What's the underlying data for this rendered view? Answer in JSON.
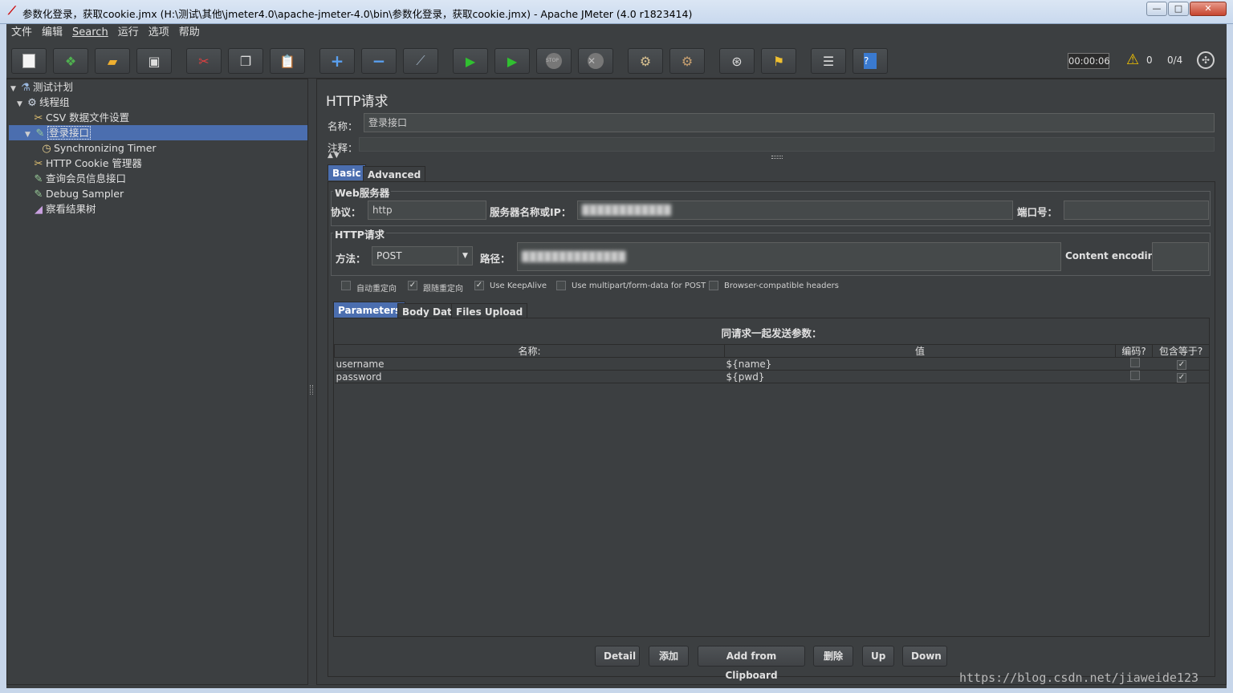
{
  "window": {
    "title": "参数化登录，获取cookie.jmx (H:\\测试\\其他\\jmeter4.0\\apache-jmeter-4.0\\bin\\参数化登录，获取cookie.jmx) - Apache JMeter (4.0 r1823414)",
    "minimize": "—",
    "maximize": "□",
    "close": "✕"
  },
  "menu": [
    "文件",
    "编辑",
    "Search",
    "运行",
    "选项",
    "帮助"
  ],
  "toolbar": {
    "timer": "00:00:06",
    "warning_count": "0",
    "threads": "0/4"
  },
  "tree": [
    {
      "label": "测试计划",
      "icon": "flask-icon"
    },
    {
      "label": "线程组",
      "icon": "gear-icon"
    },
    {
      "label": "CSV 数据文件设置",
      "icon": "scissors-icon"
    },
    {
      "label": "登录接口",
      "icon": "pipette-icon"
    },
    {
      "label": "Synchronizing Timer",
      "icon": "timer-icon"
    },
    {
      "label": "HTTP Cookie 管理器",
      "icon": "scissors-icon"
    },
    {
      "label": "查询会员信息接口",
      "icon": "pipette-icon"
    },
    {
      "label": "Debug Sampler",
      "icon": "pipette-icon"
    },
    {
      "label": "察看结果树",
      "icon": "graph-icon"
    }
  ],
  "panel": {
    "title": "HTTP请求",
    "name_label": "名称：",
    "name_value": "登录接口",
    "comment_label": "注释：",
    "tabs": [
      "Basic",
      "Advanced"
    ],
    "web_server": {
      "group_title": "Web服务器",
      "protocol_label": "协议：",
      "protocol_value": "http",
      "server_label": "服务器名称或IP：",
      "server_value": "████████████",
      "port_label": "端口号："
    },
    "http_request": {
      "group_title": "HTTP请求",
      "method_label": "方法：",
      "method_value": "POST",
      "path_label": "路径：",
      "path_value": "██████████████",
      "encoding_label": "Content encoding:"
    },
    "checkboxes": [
      {
        "label": "自动重定向",
        "checked": false
      },
      {
        "label": "跟随重定向",
        "checked": true
      },
      {
        "label": "Use KeepAlive",
        "checked": true
      },
      {
        "label": "Use multipart/form-data for POST",
        "checked": false
      },
      {
        "label": "Browser-compatible headers",
        "checked": false
      }
    ],
    "subtabs": [
      "Parameters",
      "Body Data",
      "Files Upload"
    ],
    "params_caption": "同请求一起发送参数：",
    "columns": [
      "名称:",
      "值",
      "编码?",
      "包含等于?"
    ],
    "rows": [
      {
        "name": "username",
        "value": "${name}",
        "encode": false,
        "include_equals": true
      },
      {
        "name": "password",
        "value": "${pwd}",
        "encode": false,
        "include_equals": true
      }
    ],
    "buttons": [
      "Detail",
      "添加",
      "Add from Clipboard",
      "删除",
      "Up",
      "Down"
    ]
  },
  "watermark": "https://blog.csdn.net/jiaweide123"
}
